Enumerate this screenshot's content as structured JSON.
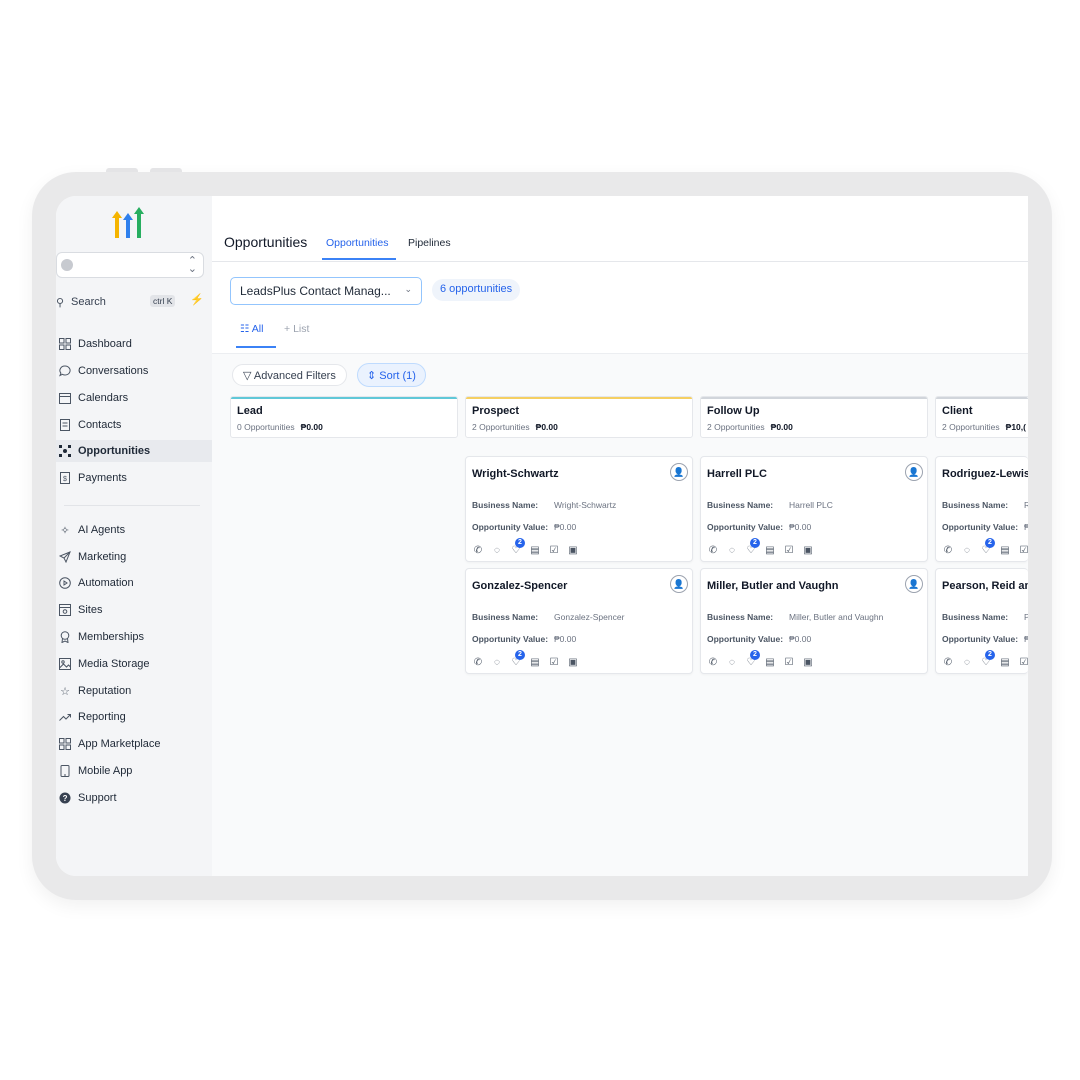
{
  "app": {
    "title": "Opportunities"
  },
  "sidebar": {
    "search_label": "Search",
    "search_shortcut": "ctrl K",
    "items": [
      {
        "label": "Dashboard",
        "icon": "dashboard-icon"
      },
      {
        "label": "Conversations",
        "icon": "chat-icon"
      },
      {
        "label": "Calendars",
        "icon": "calendar-icon"
      },
      {
        "label": "Contacts",
        "icon": "contacts-icon"
      },
      {
        "label": "Opportunities",
        "icon": "opportunities-icon",
        "active": true
      },
      {
        "label": "Payments",
        "icon": "payments-icon"
      },
      {
        "label": "AI Agents",
        "icon": "sparkle-icon"
      },
      {
        "label": "Marketing",
        "icon": "send-icon"
      },
      {
        "label": "Automation",
        "icon": "automation-icon"
      },
      {
        "label": "Sites",
        "icon": "sites-icon"
      },
      {
        "label": "Memberships",
        "icon": "badge-icon"
      },
      {
        "label": "Media Storage",
        "icon": "image-icon"
      },
      {
        "label": "Reputation",
        "icon": "star-icon"
      },
      {
        "label": "Reporting",
        "icon": "trend-icon"
      },
      {
        "label": "App Marketplace",
        "icon": "grid-icon"
      },
      {
        "label": "Mobile App",
        "icon": "phone-icon"
      },
      {
        "label": "Support",
        "icon": "help-icon"
      }
    ]
  },
  "header": {
    "title": "Opportunities",
    "tabs": [
      {
        "label": "Opportunities",
        "active": true
      },
      {
        "label": "Pipelines",
        "active": false
      }
    ]
  },
  "toolbar": {
    "pipeline": "LeadsPlus Contact Manag...",
    "count": "6 opportunities",
    "views": [
      {
        "label": "All",
        "active": true
      },
      {
        "label": "List",
        "active": false
      }
    ],
    "filters_label": "Advanced Filters",
    "sort_label": "Sort (1)"
  },
  "labels": {
    "business_name": "Business Name:",
    "opportunity_value": "Opportunity Value:"
  },
  "colors": {
    "accent": "#2563eb",
    "lead_bar": "#60c8d8",
    "prospect_bar": "#f5cf62",
    "followup_bar": "#d1d5db"
  },
  "stages": [
    {
      "name": "Lead",
      "count": "0 Opportunities",
      "amount": "₱0.00"
    },
    {
      "name": "Prospect",
      "count": "2 Opportunities",
      "amount": "₱0.00"
    },
    {
      "name": "Follow Up",
      "count": "2 Opportunities",
      "amount": "₱0.00"
    },
    {
      "name": "Client",
      "count": "2 Opportunities",
      "amount": "₱10,("
    }
  ],
  "cards": {
    "prospect": [
      {
        "title": "Wright-Schwartz",
        "business": "Wright-Schwartz",
        "value": "₱0.00",
        "badge": "2"
      },
      {
        "title": "Gonzalez-Spencer",
        "business": "Gonzalez-Spencer",
        "value": "₱0.00",
        "badge": "2"
      }
    ],
    "followup": [
      {
        "title": "Harrell PLC",
        "business": "Harrell PLC",
        "value": "₱0.00",
        "badge": "2"
      },
      {
        "title": "Miller, Butler and Vaughn",
        "business": "Miller, Butler and Vaughn",
        "value": "₱0.00",
        "badge": "2"
      }
    ],
    "client": [
      {
        "title": "Rodriguez-Lewis",
        "business": "R",
        "value": "₱",
        "badge": "2"
      },
      {
        "title": "Pearson, Reid and",
        "business": "P",
        "value": "₱",
        "badge": "2"
      }
    ]
  }
}
